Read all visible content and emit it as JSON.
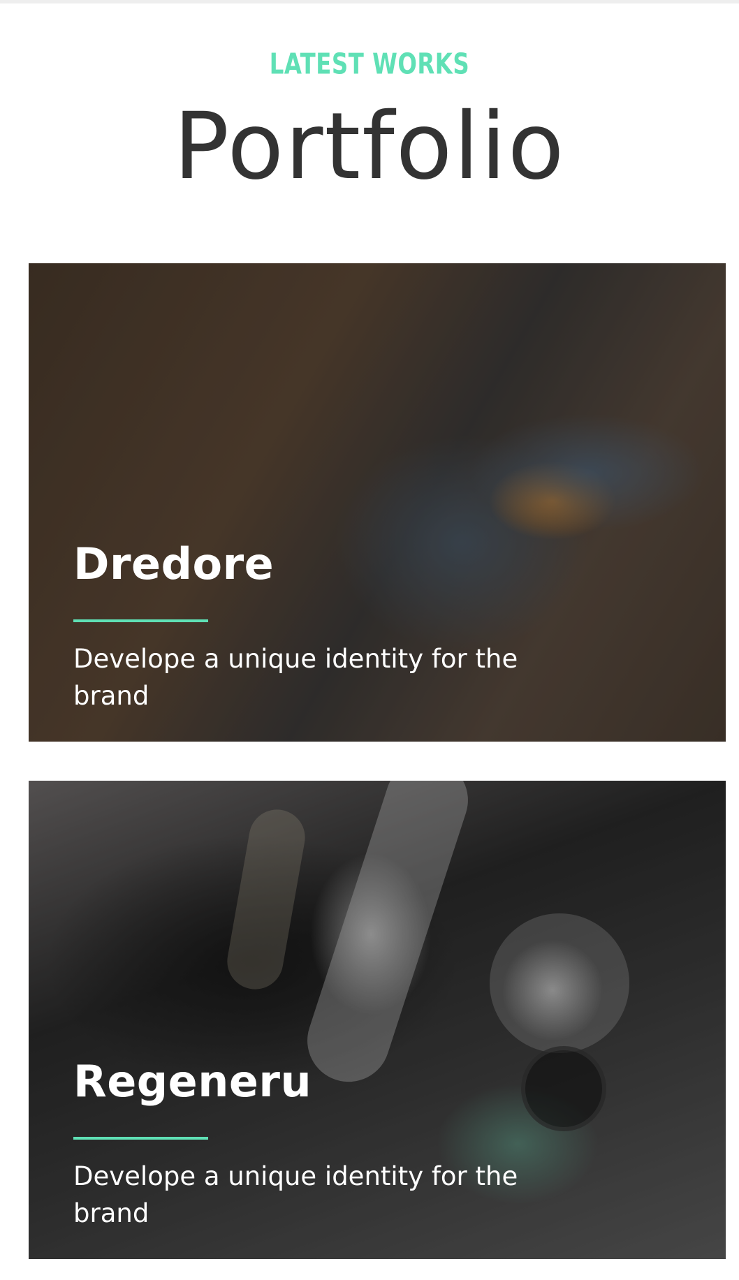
{
  "header": {
    "eyebrow": "LATEST WORKS",
    "title": "Portfolio"
  },
  "colors": {
    "accent": "#5fe0b5",
    "title_text": "#333333",
    "card_text": "#ffffff"
  },
  "portfolio": {
    "items": [
      {
        "title": "Dredore",
        "description": "Develope a unique identity for the brand",
        "image": "architecture-curved-walls-photo"
      },
      {
        "title": "Regeneru",
        "description": "Develope a unique identity for the brand",
        "image": "cosmetics-box-flatlay-photo"
      }
    ]
  }
}
